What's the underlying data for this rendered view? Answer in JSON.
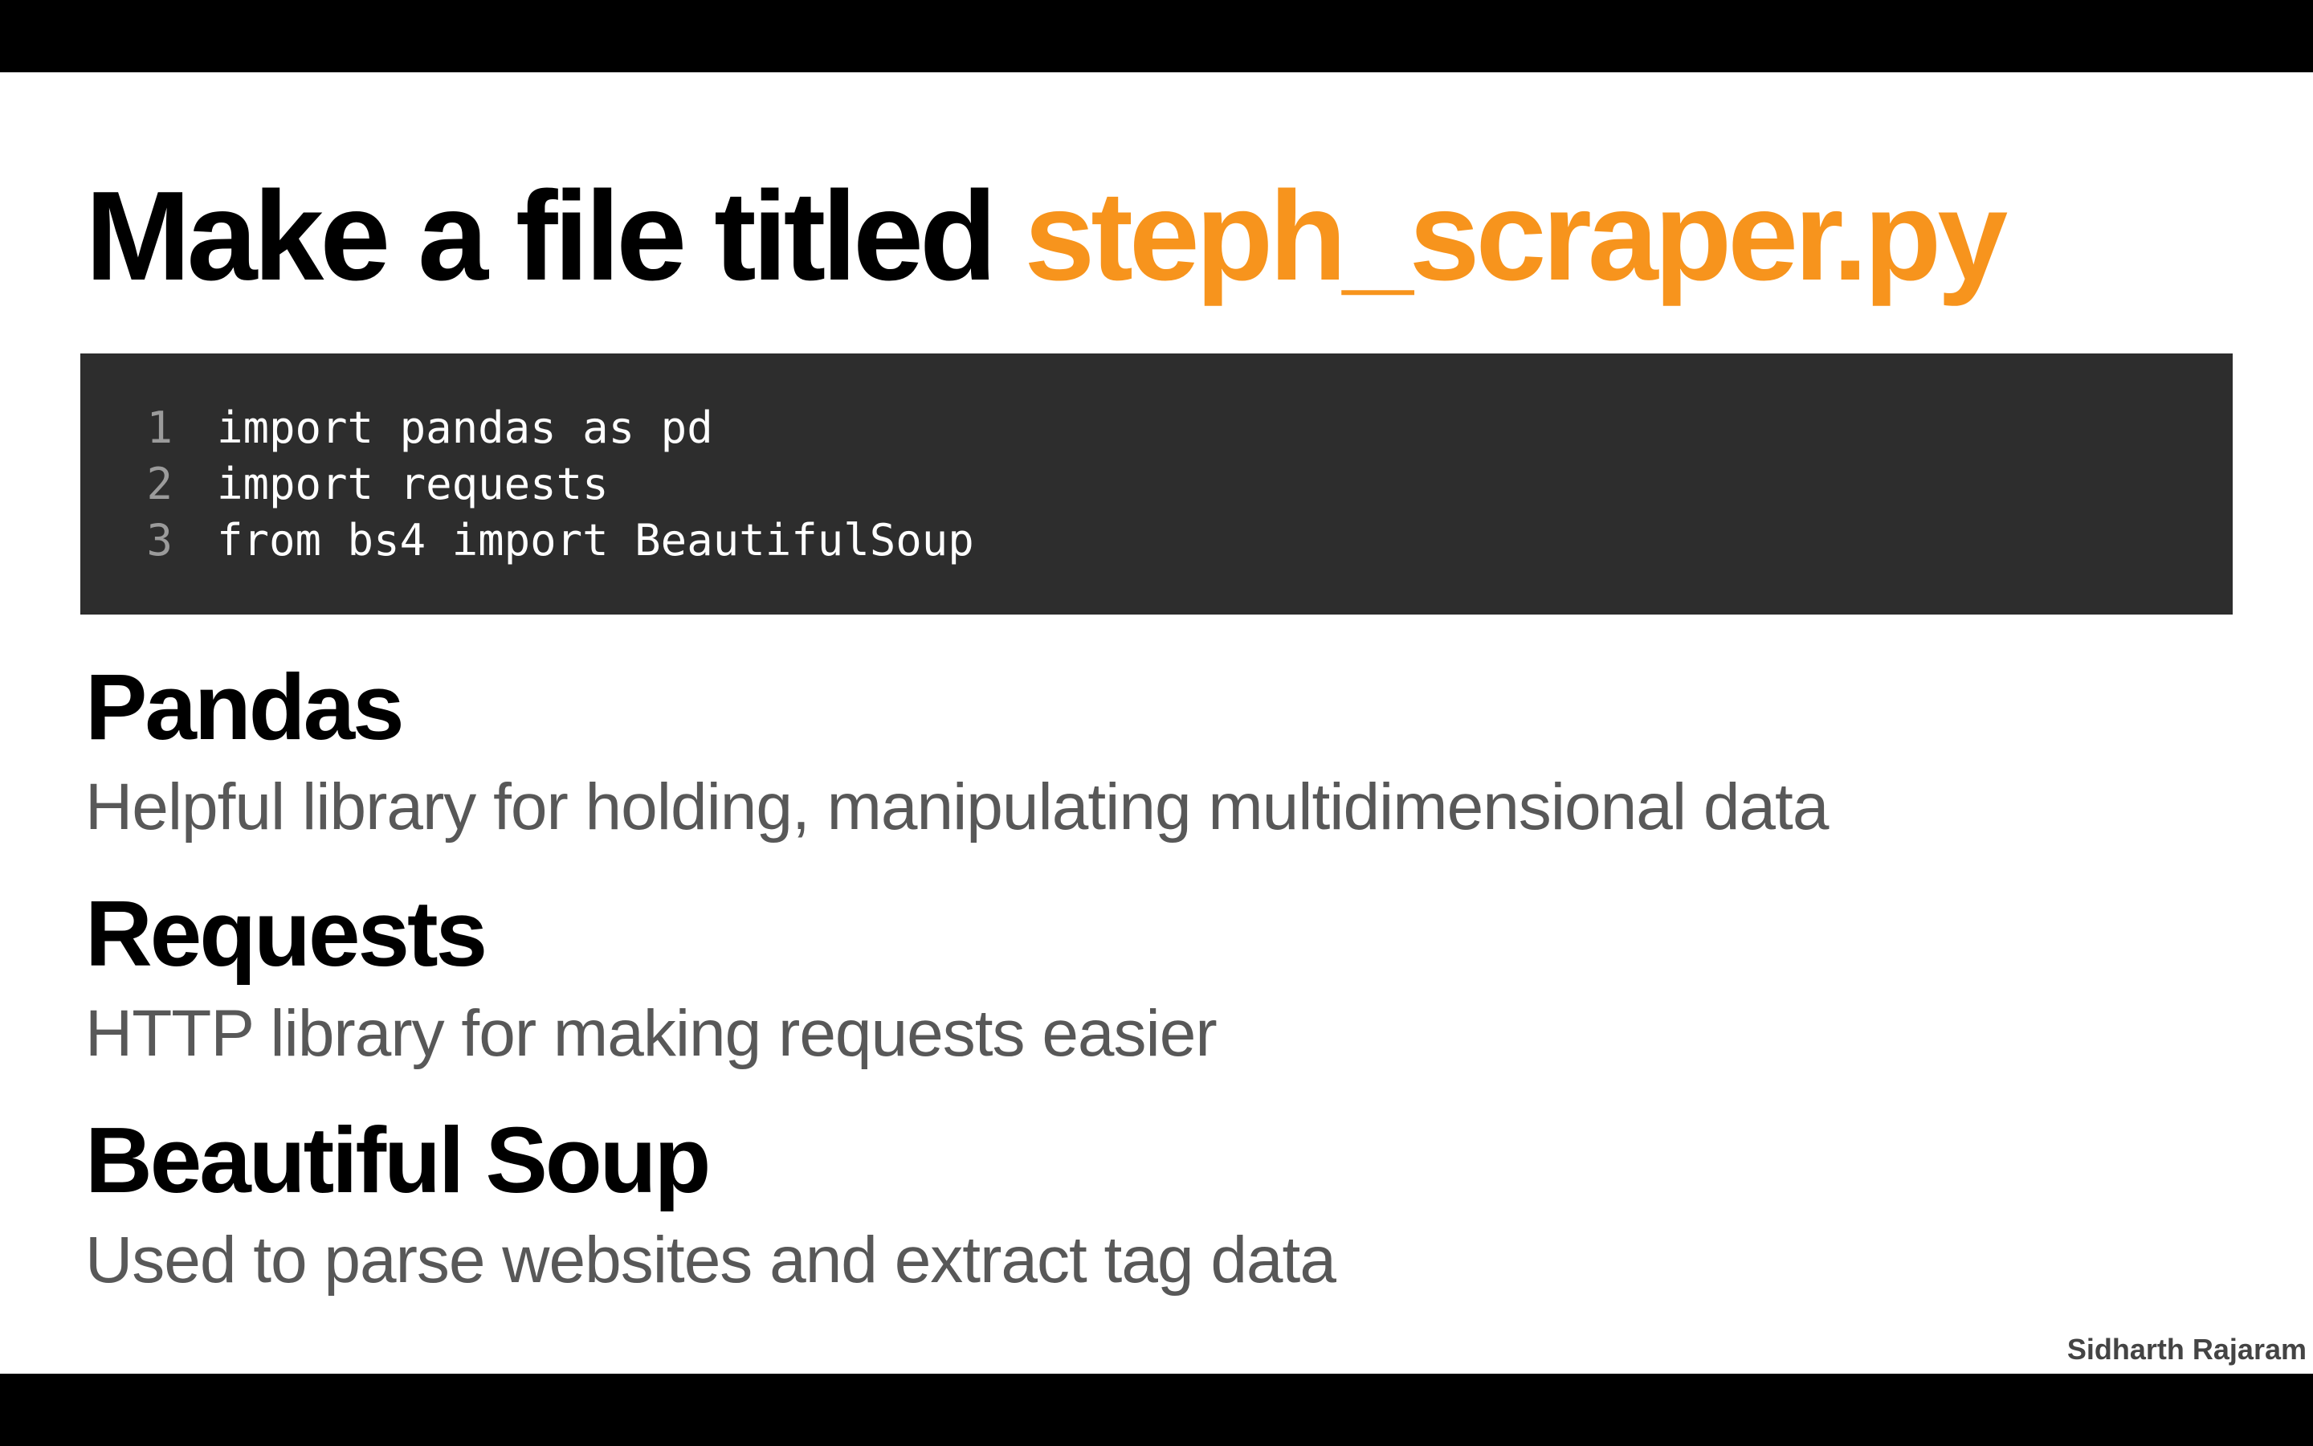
{
  "slide": {
    "title_prefix": "Make a file titled ",
    "title_filename": "steph_scraper.py",
    "accent_color": "#f7941d"
  },
  "code": {
    "background": "#2d2d2d",
    "lines": [
      {
        "number": "1",
        "text": "import pandas as pd"
      },
      {
        "number": "2",
        "text": "import requests"
      },
      {
        "number": "3",
        "text": "from bs4 import BeautifulSoup"
      }
    ]
  },
  "sections": [
    {
      "heading": "Pandas",
      "description": "Helpful library for holding, manipulating multidimensional data"
    },
    {
      "heading": "Requests",
      "description": "HTTP library for making requests easier"
    },
    {
      "heading": "Beautiful Soup",
      "description": "Used to parse websites and extract tag data"
    }
  ],
  "footer": {
    "author": "Sidharth Rajaram"
  }
}
